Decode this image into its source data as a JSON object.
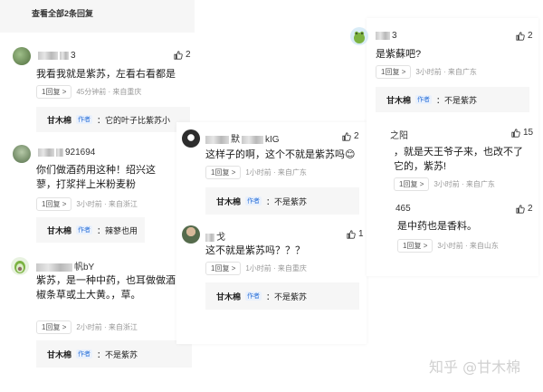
{
  "col1": {
    "view_all": "查看全部2条回复",
    "c1": {
      "user": "3",
      "likes": "2",
      "text": "我看我就是紫苏，左看右看都是",
      "reply": "1回复",
      "arrow": ">",
      "time": "45分钟前 · 来自重庆",
      "sub_author": "甘木棉",
      "tag": "作者",
      "sub_text": "：它的叶子比紫苏小"
    },
    "c2": {
      "user": "921694",
      "text": "你们做酒药用这种！绍兴这蓼，打浆拌上米粉麦粉",
      "reply": "1回复",
      "arrow": ">",
      "time": "3小时前 · 来自浙江",
      "sub_author": "甘木棉",
      "tag": "作者",
      "sub_text": "：辣蓼也用"
    },
    "c3": {
      "user": "帆bY",
      "text": "紫苏，是一种中药，也耳做做酒曲椒条草或土大黄。，草。",
      "reply": "1回复",
      "arrow": ">",
      "time": "2小时前 · 来自浙江",
      "sub_author": "甘木棉",
      "tag": "作者",
      "sub_text": "：不是紫苏"
    }
  },
  "col2": {
    "c1": {
      "user_a": "默",
      "user_b": "kIG",
      "likes": "2",
      "text": "这样子的啊，这个不就是紫苏吗😊",
      "reply": "1回复",
      "arrow": ">",
      "time": "1小时前 · 来自广东",
      "sub_author": "甘木棉",
      "tag": "作者",
      "sub_text": "：不是紫苏"
    },
    "c2": {
      "user": "戈",
      "likes": "1",
      "text": "这不就是紫苏吗？？？",
      "reply": "1回复",
      "arrow": ">",
      "time": "1小时前 · 来自重庆",
      "sub_author": "甘木棉",
      "tag": "作者",
      "sub_text": "：不是紫苏"
    }
  },
  "col3": {
    "c1": {
      "user": "3",
      "likes": "2",
      "text": "是紫蘇吧?",
      "reply": "1回复",
      "arrow": ">",
      "time": "3小时前 · 来自广东",
      "sub_author": "甘木棉",
      "tag": "作者",
      "sub_text": "：不是紫苏"
    },
    "c2": {
      "user": "之阳",
      "likes": "15",
      "text": "，就是天王爷子来，也改不了它的，紫苏!",
      "reply": "1回复",
      "arrow": ">",
      "time": "3小时前 · 来自广东"
    },
    "c3": {
      "user": "465",
      "likes": "2",
      "text": "是中药也是香料。",
      "reply": "1回复",
      "arrow": ">",
      "time": "3小时前 · 来自山东"
    }
  },
  "watermark": "知乎 @甘木棉",
  "icons": {
    "like": "thumbs-up-icon"
  },
  "colors": {
    "accent_blue": "#2e73d9",
    "meta_gray": "#999999"
  }
}
